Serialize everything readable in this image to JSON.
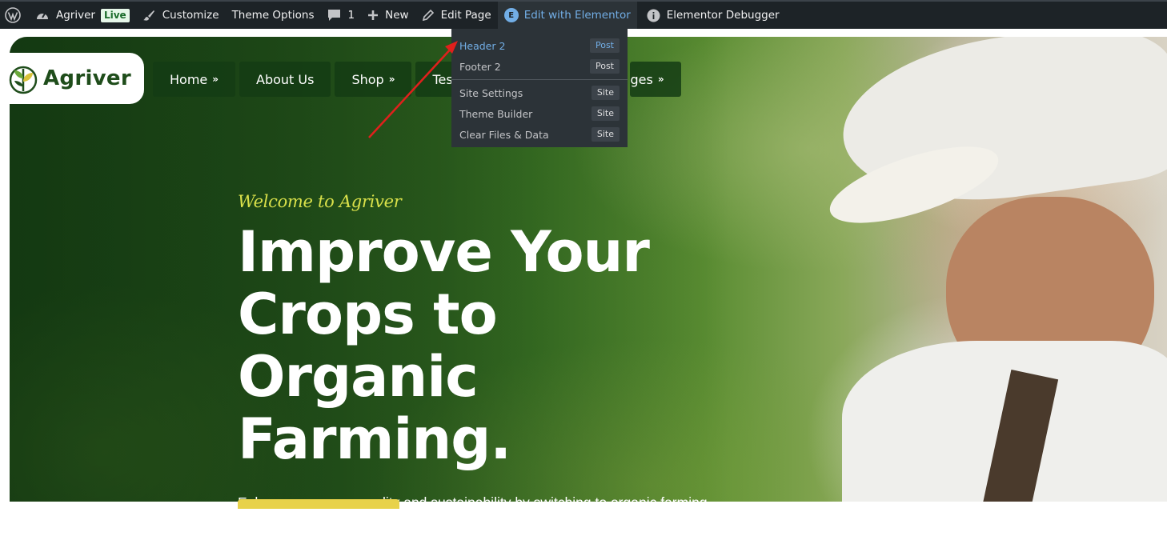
{
  "admin_bar": {
    "site_name": "Agriver",
    "live_badge": "Live",
    "customize": "Customize",
    "theme_options": "Theme Options",
    "comments_count": "1",
    "new": "New",
    "edit_page": "Edit Page",
    "edit_with_elementor": "Edit with Elementor",
    "elementor_debugger": "Elementor Debugger"
  },
  "elementor_menu": {
    "items": [
      {
        "label": "Header 2",
        "badge": "Post"
      },
      {
        "label": "Footer 2",
        "badge": "Post"
      },
      {
        "label": "Site Settings",
        "badge": "Site"
      },
      {
        "label": "Theme Builder",
        "badge": "Site"
      },
      {
        "label": "Clear Files & Data",
        "badge": "Site"
      }
    ]
  },
  "site": {
    "logo_text": "Agriver",
    "nav": [
      {
        "label": "Home",
        "has_dropdown": true
      },
      {
        "label": "About Us",
        "has_dropdown": false
      },
      {
        "label": "Shop",
        "has_dropdown": true
      },
      {
        "label": "Test",
        "has_dropdown": false
      },
      {
        "label": "ges",
        "has_dropdown": true
      }
    ]
  },
  "hero": {
    "welcome": "Welcome to Agriver",
    "headline": "Improve Your Crops to Organic Farming.",
    "description": "Enhance your crop quality and sustainability by switching to organic farming practices that prioritize."
  },
  "colors": {
    "admin_bar_bg": "#1d2327",
    "admin_link_active": "#72aee6",
    "brand_green": "#1f4d1b",
    "accent_yellow": "#d9e04a",
    "annotation_red": "#e0201c"
  }
}
